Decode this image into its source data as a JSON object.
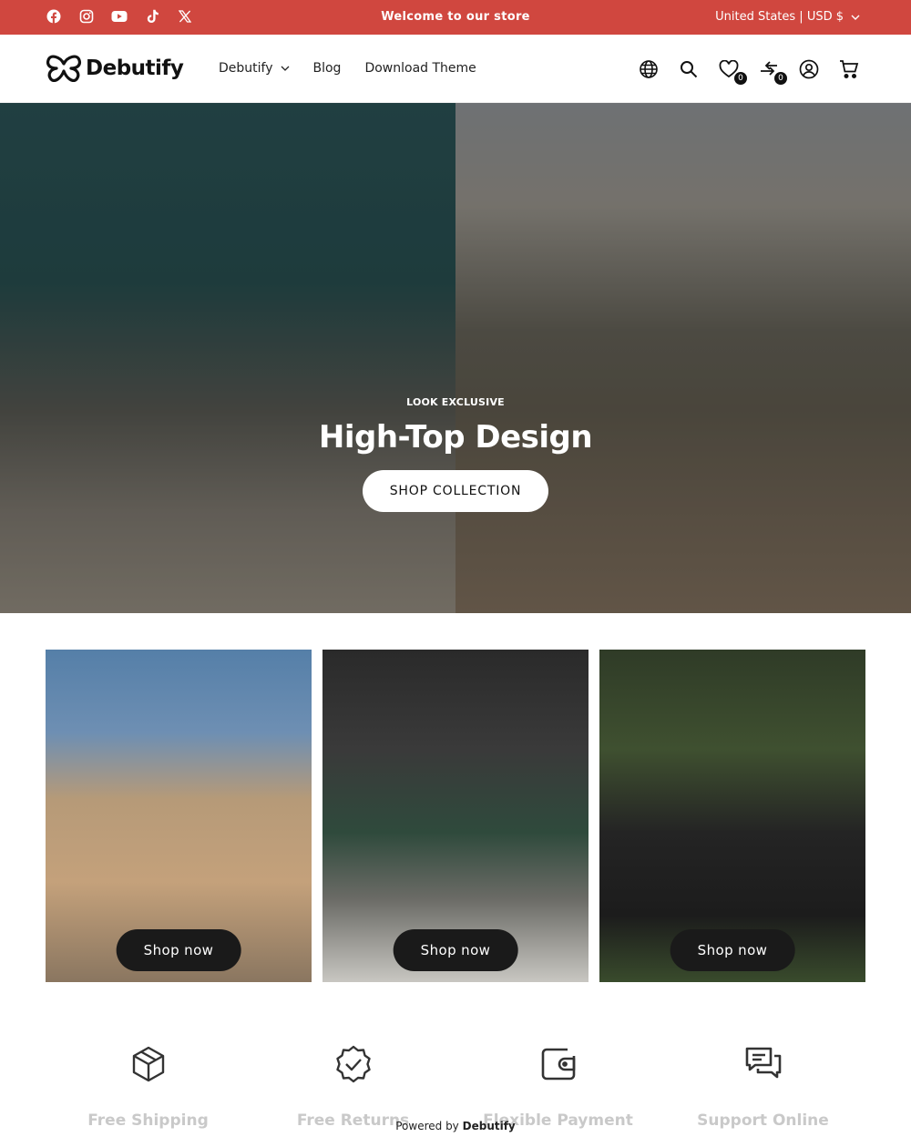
{
  "announcement": {
    "text": "Welcome to our store",
    "locale": "United States | USD $",
    "social_icons": [
      "facebook-icon",
      "instagram-icon",
      "youtube-icon",
      "tiktok-icon",
      "x-icon"
    ]
  },
  "header": {
    "logo_text": "Debutify",
    "nav": [
      {
        "label": "Debutify",
        "has_dropdown": true
      },
      {
        "label": "Blog"
      },
      {
        "label": "Download Theme"
      }
    ],
    "icons": [
      "globe-icon",
      "search-icon",
      "wishlist-icon",
      "compare-icon",
      "account-icon",
      "cart-icon"
    ],
    "wishlist_count": "0",
    "compare_count": "0"
  },
  "hero": {
    "eyebrow": "LOOK EXCLUSIVE",
    "title": "High-Top Design",
    "button": "SHOP COLLECTION"
  },
  "collections": [
    {
      "button": "Shop now"
    },
    {
      "button": "Shop now"
    },
    {
      "button": "Shop now"
    }
  ],
  "features": [
    {
      "icon": "box-icon",
      "title": "Free Shipping"
    },
    {
      "icon": "verified-badge-icon",
      "title": "Free Returns"
    },
    {
      "icon": "wallet-icon",
      "title": "Flexible Payment"
    },
    {
      "icon": "chat-icon",
      "title": "Support Online"
    }
  ],
  "footer": {
    "powered_prefix": "Powered by",
    "powered_brand": "Debutify"
  },
  "colors": {
    "announcement_bg": "#d0473f",
    "button_dark": "#1a1a1a",
    "text": "#1b1b1b"
  }
}
